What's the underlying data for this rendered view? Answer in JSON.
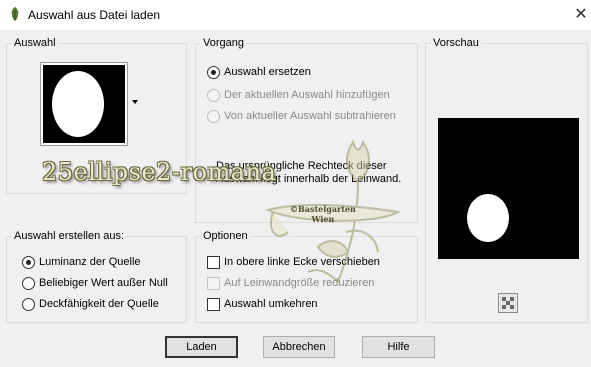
{
  "window": {
    "title": "Auswahl aus Datei laden",
    "close": "✕"
  },
  "auswahl": {
    "legend": "Auswahl"
  },
  "vorgang": {
    "legend": "Vorgang",
    "options": [
      {
        "label": "Auswahl ersetzen",
        "checked": true,
        "disabled": false
      },
      {
        "label": "Der aktuellen Auswahl hinzufügen",
        "checked": false,
        "disabled": true
      },
      {
        "label": "Von aktueller Auswahl subtrahieren",
        "checked": false,
        "disabled": true
      }
    ],
    "note": "Das ursprüngliche Rechteck dieser Auswahl liegt innerhalb der Leinwand."
  },
  "vorschau": {
    "legend": "Vorschau"
  },
  "erstellen": {
    "legend": "Auswahl erstellen aus:",
    "options": [
      {
        "label": "Luminanz der Quelle",
        "checked": true
      },
      {
        "label": "Beliebiger Wert außer Null",
        "checked": false
      },
      {
        "label": "Deckfähigkeit der Quelle",
        "checked": false
      }
    ]
  },
  "optionen": {
    "legend": "Optionen",
    "options": [
      {
        "label": "In obere linke Ecke verschieben",
        "checked": false,
        "disabled": false
      },
      {
        "label": "Auf Leinwandgröße reduzieren",
        "checked": false,
        "disabled": true
      },
      {
        "label": "Auswahl umkehren",
        "checked": false,
        "disabled": false
      }
    ]
  },
  "buttons": {
    "load": "Laden",
    "cancel": "Abbrechen",
    "help": "Hilfe"
  },
  "watermark": {
    "text": "25ellipse2-romana",
    "stamp_line1": "©Bastelgarten",
    "stamp_line2": "Wien"
  },
  "colors": {
    "accent": "#000000",
    "disabled_text": "#8a8a8a",
    "watermark_text": "#e8e6cc"
  }
}
